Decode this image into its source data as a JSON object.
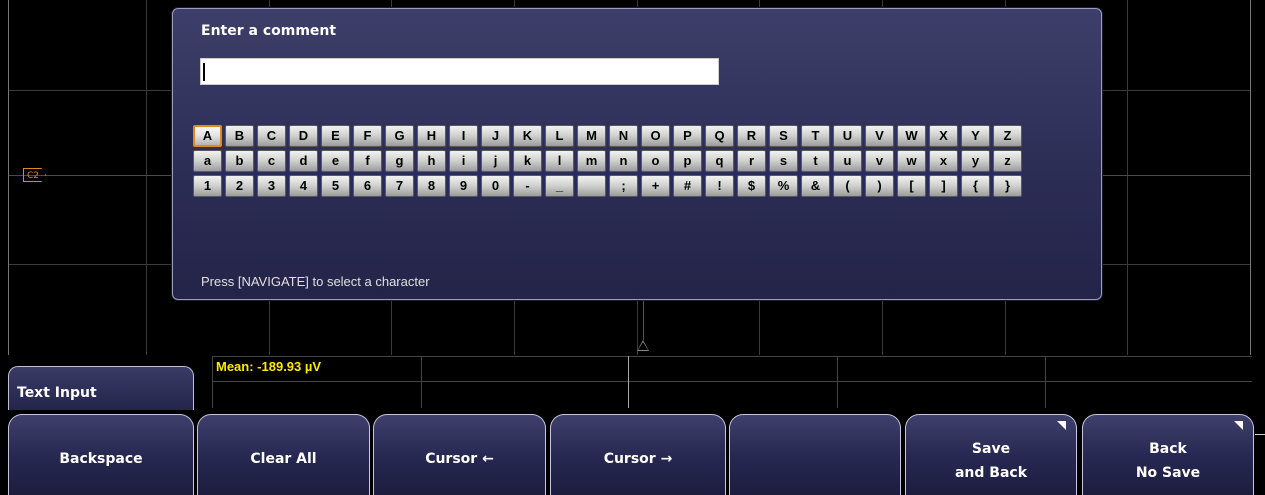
{
  "dialog": {
    "title": "Enter a comment",
    "input_value": "",
    "hint": "Press [NAVIGATE] to select a character"
  },
  "keyboard": {
    "rows": [
      [
        "A",
        "B",
        "C",
        "D",
        "E",
        "F",
        "G",
        "H",
        "I",
        "J",
        "K",
        "L",
        "M",
        "N",
        "O",
        "P",
        "Q",
        "R",
        "S",
        "T",
        "U",
        "V",
        "W",
        "X",
        "Y",
        "Z"
      ],
      [
        "a",
        "b",
        "c",
        "d",
        "e",
        "f",
        "g",
        "h",
        "i",
        "j",
        "k",
        "l",
        "m",
        "n",
        "o",
        "p",
        "q",
        "r",
        "s",
        "t",
        "u",
        "v",
        "w",
        "x",
        "y",
        "z"
      ],
      [
        "1",
        "2",
        "3",
        "4",
        "5",
        "6",
        "7",
        "8",
        "9",
        "0",
        "-",
        "_",
        " ",
        ";",
        "+",
        "#",
        "!",
        "$",
        "%",
        "&",
        "(",
        ")",
        "[",
        "]",
        "{",
        "}"
      ]
    ],
    "selected": "A"
  },
  "channel_marker": "C2",
  "measurement": {
    "mean_text": "Mean: -189.93 µV",
    "color": "#ffe800"
  },
  "menu": {
    "title": "Text Input"
  },
  "softkeys": [
    {
      "id": "backspace",
      "lines": [
        "Backspace"
      ],
      "corner": false
    },
    {
      "id": "clear-all",
      "lines": [
        "Clear All"
      ],
      "corner": false
    },
    {
      "id": "cursor-left",
      "lines": [
        "Cursor ←"
      ],
      "corner": false
    },
    {
      "id": "cursor-right",
      "lines": [
        "Cursor →"
      ],
      "corner": false
    },
    {
      "id": "empty",
      "lines": [
        ""
      ],
      "corner": false
    },
    {
      "id": "save-and-back",
      "lines": [
        "Save",
        "and Back"
      ],
      "corner": true
    },
    {
      "id": "back-no-save",
      "lines": [
        "Back",
        "No Save"
      ],
      "corner": true
    }
  ],
  "colors": {
    "accent": "#e08a1c",
    "dialog_bg": "#2b2c54",
    "measure_text": "#ffe800"
  }
}
